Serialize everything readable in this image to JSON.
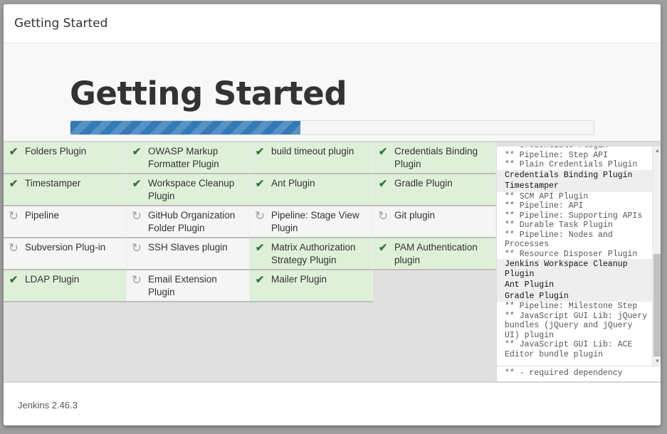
{
  "header": {
    "title": "Getting Started"
  },
  "hero": {
    "title": "Getting Started",
    "progress_fraction": 0.44
  },
  "plugins": [
    {
      "name": "Folders Plugin",
      "status": "installed",
      "icon": "check-icon"
    },
    {
      "name": "OWASP Markup Formatter Plugin",
      "status": "installed",
      "icon": "check-icon"
    },
    {
      "name": "build timeout plugin",
      "status": "installed",
      "icon": "check-icon"
    },
    {
      "name": "Credentials Binding Plugin",
      "status": "installed",
      "icon": "check-icon"
    },
    {
      "name": "Timestamper",
      "status": "installed",
      "icon": "check-icon"
    },
    {
      "name": "Workspace Cleanup Plugin",
      "status": "installed",
      "icon": "check-icon"
    },
    {
      "name": "Ant Plugin",
      "status": "installed",
      "icon": "check-icon"
    },
    {
      "name": "Gradle Plugin",
      "status": "installed",
      "icon": "check-icon"
    },
    {
      "name": "Pipeline",
      "status": "pending",
      "icon": "refresh-icon"
    },
    {
      "name": "GitHub Organization Folder Plugin",
      "status": "pending",
      "icon": "refresh-icon"
    },
    {
      "name": "Pipeline: Stage View Plugin",
      "status": "pending",
      "icon": "refresh-icon"
    },
    {
      "name": "Git plugin",
      "status": "pending",
      "icon": "refresh-icon"
    },
    {
      "name": "Subversion Plug-in",
      "status": "pending",
      "icon": "refresh-icon"
    },
    {
      "name": "SSH Slaves plugin",
      "status": "pending",
      "icon": "refresh-icon"
    },
    {
      "name": "Matrix Authorization Strategy Plugin",
      "status": "installed",
      "icon": "check-icon"
    },
    {
      "name": "PAM Authentication plugin",
      "status": "installed",
      "icon": "check-icon"
    },
    {
      "name": "LDAP Plugin",
      "status": "installed",
      "icon": "check-icon"
    },
    {
      "name": "Email Extension Plugin",
      "status": "pending",
      "icon": "refresh-icon"
    },
    {
      "name": "Mailer Plugin",
      "status": "installed",
      "icon": "check-icon"
    }
  ],
  "log": {
    "lines": [
      {
        "text": "** Credentials Plugin",
        "type": "dep"
      },
      {
        "text": "** Pipeline: Step API",
        "type": "dep"
      },
      {
        "text": "** Plain Credentials Plugin",
        "type": "dep"
      },
      {
        "text": "Credentials Binding Plugin",
        "type": "main"
      },
      {
        "text": "Timestamper",
        "type": "main"
      },
      {
        "text": "** SCM API Plugin",
        "type": "dep"
      },
      {
        "text": "** Pipeline: API",
        "type": "dep"
      },
      {
        "text": "** Pipeline: Supporting APIs",
        "type": "dep"
      },
      {
        "text": "** Durable Task Plugin",
        "type": "dep"
      },
      {
        "text": "** Pipeline: Nodes and Processes",
        "type": "dep"
      },
      {
        "text": "** Resource Disposer Plugin",
        "type": "dep"
      },
      {
        "text": "Jenkins Workspace Cleanup Plugin",
        "type": "main"
      },
      {
        "text": "Ant Plugin",
        "type": "main"
      },
      {
        "text": "Gradle Plugin",
        "type": "main"
      },
      {
        "text": "** Pipeline: Milestone Step",
        "type": "dep"
      },
      {
        "text": "** JavaScript GUI Lib: jQuery bundles (jQuery and jQuery UI) plugin",
        "type": "dep"
      },
      {
        "text": "** JavaScript GUI Lib: ACE Editor bundle plugin",
        "type": "dep"
      }
    ],
    "footer": "** - required dependency"
  },
  "footer": {
    "version": "Jenkins 2.46.3"
  },
  "colors": {
    "installed_bg": "#dff0d8",
    "pending_bg": "#f5f5f5",
    "check": "#3c763d",
    "progress": "#337ab7"
  }
}
